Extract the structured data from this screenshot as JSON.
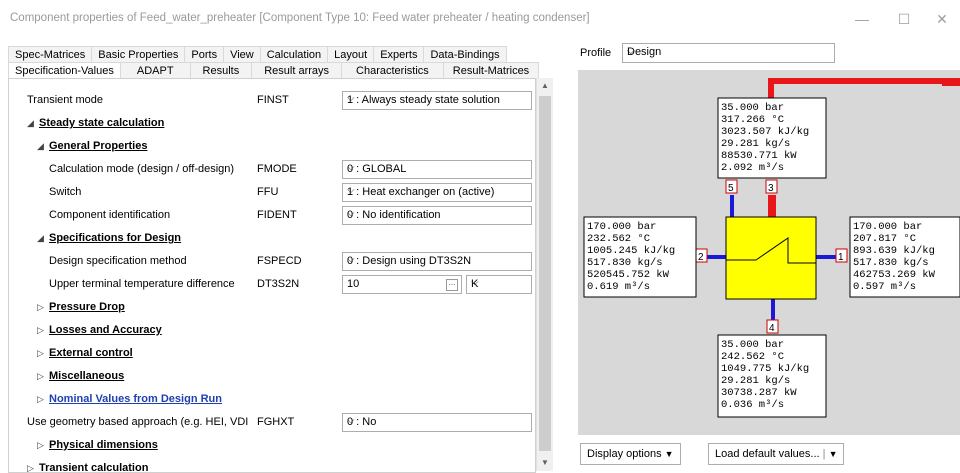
{
  "window": {
    "title": "Component properties of Feed_water_preheater   [Component Type 10: Feed water preheater / heating condenser]",
    "minimize": "—",
    "maximize": "☐",
    "close": "✕"
  },
  "tabs": {
    "row1": [
      "Spec-Matrices",
      "Basic Properties",
      "Ports",
      "View",
      "Calculation",
      "Layout",
      "Experts",
      "Data-Bindings"
    ],
    "row2": [
      "Specification-Values",
      "ADAPT",
      "Results",
      "Result arrays",
      "Characteristics",
      "Result-Matrices"
    ],
    "active": "Specification-Values"
  },
  "props": {
    "transient_mode": {
      "label": "Transient mode",
      "code": "FINST",
      "value": "1 : Always steady state solution"
    },
    "steady_state": "Steady state calculation",
    "general_props": "General Properties",
    "calc_mode": {
      "label": "Calculation mode (design / off-design)",
      "code": "FMODE",
      "value": "0 : GLOBAL"
    },
    "switch": {
      "label": "Switch",
      "code": "FFU",
      "value": "1 : Heat exchanger on (active)"
    },
    "comp_id": {
      "label": "Component identification",
      "code": "FIDENT",
      "value": "0 : No identification"
    },
    "spec_design": "Specifications for Design",
    "design_method": {
      "label": "Design specification method",
      "code": "FSPECD",
      "value": "0 : Design using DT3S2N"
    },
    "upper_ttd": {
      "label": "Upper terminal temperature difference",
      "code": "DT3S2N",
      "value": "10",
      "unit": "K"
    },
    "pressure_drop": "Pressure Drop",
    "losses": "Losses and Accuracy",
    "external": "External control",
    "misc": "Miscellaneous",
    "nominal": "Nominal Values from Design Run",
    "geometry": {
      "label": "Use geometry based approach (e.g. HEI, VDI",
      "code": "FGHXT",
      "value": "0 : No"
    },
    "physical": "Physical dimensions",
    "transient_calc": "Transient calculation"
  },
  "profile": {
    "label": "Profile",
    "value": "Design"
  },
  "diagram": {
    "top": [
      "35.000 bar",
      "317.266 °C",
      "3023.507 kJ/kg",
      "29.281 kg/s",
      "88530.771 kW",
      "2.092 m³/s"
    ],
    "left": [
      "170.000 bar",
      "232.562 °C",
      "1005.245 kJ/kg",
      "517.830 kg/s",
      "520545.752 kW",
      "0.619 m³/s"
    ],
    "right": [
      "170.000 bar",
      "207.817 °C",
      "893.639 kJ/kg",
      "517.830 kg/s",
      "462753.269 kW",
      "0.597 m³/s"
    ],
    "bottom": [
      "35.000 bar",
      "242.562 °C",
      "1049.775 kJ/kg",
      "29.281 kg/s",
      "30738.287 kW",
      "0.036 m³/s"
    ],
    "ports": [
      "5",
      "3",
      "2",
      "1",
      "4"
    ],
    "colors": {
      "steam": "#e8151b",
      "water": "#1a1ad6",
      "hx": "#ffff00"
    }
  },
  "buttons": {
    "display_options": "Display options",
    "load_defaults": "Load default values..."
  }
}
